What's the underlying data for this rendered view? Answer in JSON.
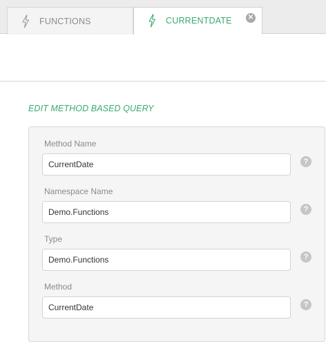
{
  "tabs": [
    {
      "label": "FUNCTIONS",
      "icon": "lightning-icon",
      "active": false
    },
    {
      "label": "CURRENTDATE",
      "icon": "lightning-icon",
      "active": true,
      "closable": true
    }
  ],
  "section": {
    "title": "EDIT METHOD BASED QUERY"
  },
  "form": {
    "fields": [
      {
        "label": "Method Name",
        "value": "CurrentDate"
      },
      {
        "label": "Namespace Name",
        "value": "Demo.Functions"
      },
      {
        "label": "Type",
        "value": "Demo.Functions"
      },
      {
        "label": "Method",
        "value": "CurrentDate"
      }
    ],
    "help_glyph": "?"
  },
  "colors": {
    "accent": "#3aaa6f",
    "inactive_tab_text": "#8b8b8b",
    "help_icon": "#c6c6c6"
  }
}
